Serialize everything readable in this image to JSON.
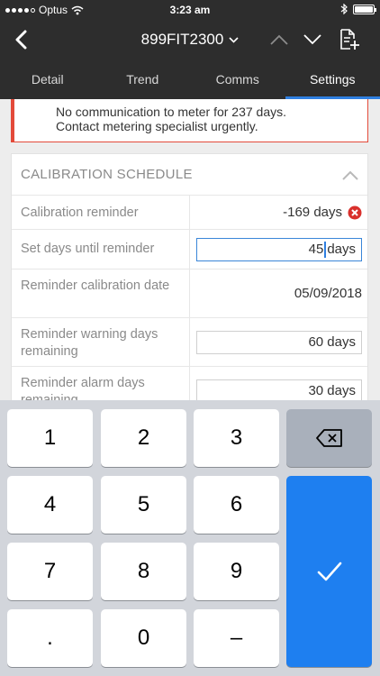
{
  "status_bar": {
    "carrier": "Optus",
    "time": "3:23 am"
  },
  "nav": {
    "title": "899FIT2300",
    "icons": {
      "back": "chevron-left-icon",
      "title_dropdown": "chevron-down-icon",
      "previous": "chevron-up-icon",
      "next": "chevron-down-icon",
      "add_note": "document-add-icon"
    }
  },
  "tabs": [
    {
      "label": "Detail",
      "active": false
    },
    {
      "label": "Trend",
      "active": false
    },
    {
      "label": "Comms",
      "active": false
    },
    {
      "label": "Settings",
      "active": true
    }
  ],
  "alert": {
    "line1": "No communication to meter for 237 days.",
    "line2": "Contact metering specialist urgently.",
    "color": "#e34a3a"
  },
  "calibration": {
    "title": "CALIBRATION SCHEDULE",
    "rows": [
      {
        "label": "Calibration reminder",
        "value": "-169 days"
      },
      {
        "label": "Set days until reminder",
        "value_before_caret": "45",
        "value_after_caret": "days"
      },
      {
        "label": "Reminder calibration date",
        "value": "05/09/2018"
      },
      {
        "label": "Reminder warning days remaining",
        "value": "60 days"
      },
      {
        "label": "Reminder alarm days remaining",
        "value": "30 days"
      }
    ]
  },
  "keypad": {
    "keys": [
      "1",
      "2",
      "3",
      "4",
      "5",
      "6",
      "7",
      "8",
      "9",
      ".",
      "0",
      "–"
    ],
    "backspace_icon": "backspace-icon",
    "done_icon": "checkmark-icon",
    "accent": "#1e7ff0"
  },
  "colors": {
    "header_bg": "#2d2d2d",
    "tab_indicator": "#2f7fe0",
    "error": "#e34a3a"
  }
}
